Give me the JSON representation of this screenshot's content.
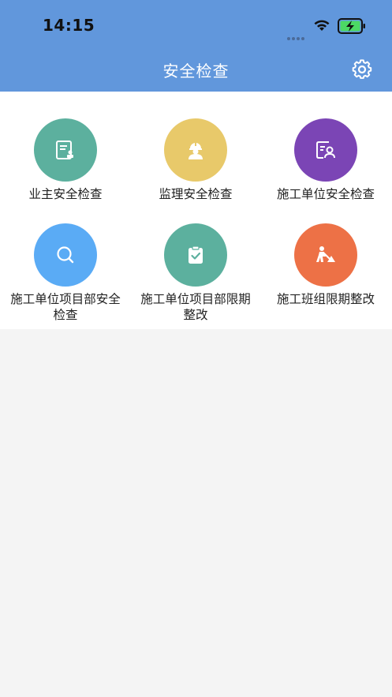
{
  "status_bar": {
    "time": "14:15"
  },
  "header": {
    "title": "安全检查",
    "settings_icon": "gear-icon"
  },
  "menu": [
    {
      "label": "业主安全检查",
      "icon": "document-stamp-icon",
      "color": "#5cb09e"
    },
    {
      "label": "监理安全检查",
      "icon": "worker-helmet-icon",
      "color": "#e8c96a"
    },
    {
      "label": "施工单位安全检查",
      "icon": "person-document-icon",
      "color": "#7b45b5"
    },
    {
      "label": "施工单位项目部安全检查",
      "icon": "search-icon",
      "color": "#5aabf5"
    },
    {
      "label": "施工单位项目部限期整改",
      "icon": "clipboard-check-icon",
      "color": "#5cb09e"
    },
    {
      "label": "施工班组限期整改",
      "icon": "construction-worker-icon",
      "color": "#ed7146"
    }
  ]
}
